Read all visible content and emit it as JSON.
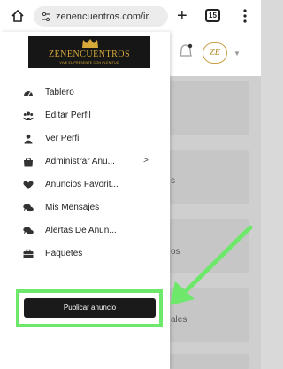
{
  "browser": {
    "url": "zenencuentros.com/ir",
    "tab_count": "15"
  },
  "logo": {
    "brand": "ZENENCUENTROS",
    "tagline": "VIVE EL PRESENTE CON PLENITUD"
  },
  "menu": [
    {
      "label": "Tablero",
      "icon": "dashboard-icon"
    },
    {
      "label": "Editar Perfil",
      "icon": "users-icon"
    },
    {
      "label": "Ver Perfil",
      "icon": "user-icon"
    },
    {
      "label": "Administrar Anu...",
      "icon": "shopping-bag-icon",
      "chevron": ">"
    },
    {
      "label": "Anuncios Favorit...",
      "icon": "heart-icon"
    },
    {
      "label": "Mis Mensajes",
      "icon": "chat-icon"
    },
    {
      "label": "Alertas De Anun...",
      "icon": "bell-chat-icon"
    },
    {
      "label": "Paquetes",
      "icon": "briefcase-icon"
    }
  ],
  "publish_button": "Publicar anuncio",
  "background": {
    "avatar_text": "ZE",
    "fragments": [
      "s",
      "os",
      "ales"
    ]
  },
  "colors": {
    "highlight": "#6ee86a",
    "logo_gold": "#d6a93a",
    "button_dark": "#1a1a1a"
  }
}
